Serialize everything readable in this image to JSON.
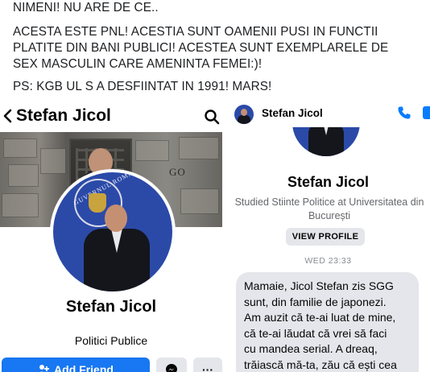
{
  "post": {
    "lines": [
      "NIMENI! NU ARE DE CE..",
      "ACESTA ESTE PNL! ACESTIA SUNT OAMENII PUSI IN FUNCTII",
      "PLATITE DIN BANI PUBLICI! ACESTEA SUNT EXEMPLARELE DE",
      "SEX MASCULIN CARE AMENINTA FEMEI:)!",
      "PS: KGB UL S A DESFIINTAT IN 1991! MARS!"
    ]
  },
  "profile": {
    "header_name": "Stefan Jicol",
    "cover_text": "GO",
    "seal_text": "GUVERNUL ROMÂNIEI",
    "name": "Stefan Jicol",
    "job": "Politici Publice",
    "add_friend_label": "Add Friend",
    "more_label": "···",
    "icons": [
      "back-arrow-icon",
      "search-icon",
      "add-friend-icon",
      "messenger-icon"
    ],
    "colors": {
      "primary": "#1877f2",
      "secondary_button": "#e4e6eb"
    }
  },
  "messenger": {
    "header_name": "Stefan Jicol",
    "name": "Stefan Jicol",
    "studied": "Studied Stiinte Politice at Universitatea din București",
    "view_profile_label": "VIEW PROFILE",
    "timestamp": "WED 23:33",
    "message_lines": [
      "Mamaie, Jicol Stefan zis SGG",
      "sunt, din familie de japonezi.",
      "Am auzit că te-ai luat de mine,",
      "că te-ai lăudat că vrei să faci",
      "cu mandea serial. A dreaq,",
      "trăiască mă-ta, zău că ești cea"
    ],
    "icons": [
      "phone-icon",
      "video-call-icon"
    ],
    "colors": {
      "accent": "#0a7cff",
      "bubble": "#e4e6eb"
    }
  }
}
